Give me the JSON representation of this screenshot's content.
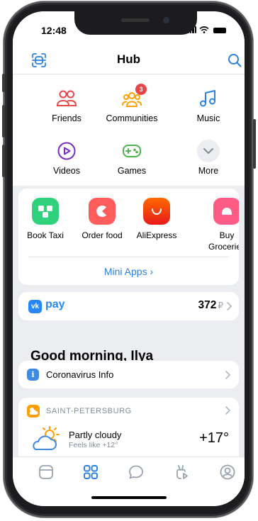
{
  "status_bar": {
    "time": "12:48"
  },
  "header": {
    "title": "Hub",
    "scan_icon": "scan-icon",
    "search_icon": "search-icon"
  },
  "services": [
    {
      "label": "Friends",
      "icon": "friends-icon",
      "color": "#e64646"
    },
    {
      "label": "Communities",
      "icon": "communities-icon",
      "color": "#ffa000",
      "badge": "3"
    },
    {
      "label": "Music",
      "icon": "music-icon",
      "color": "#2d81e0"
    },
    {
      "label": "Videos",
      "icon": "videos-icon",
      "color": "#792ec0"
    },
    {
      "label": "Games",
      "icon": "games-icon",
      "color": "#4bb34b"
    },
    {
      "label": "More",
      "icon": "chevron-down-icon",
      "color": "#818c99"
    }
  ],
  "mini_apps": {
    "items": [
      {
        "label": "Book Taxi",
        "color": "#2fd17c"
      },
      {
        "label": "Order food",
        "color": "#ff5c5c"
      },
      {
        "label": "AliExpress",
        "color": "#f23c0f"
      },
      {
        "label": "Buy Groceries",
        "color": "#ff5c85"
      }
    ],
    "link": "Mini Apps ›"
  },
  "vk_pay": {
    "logo": "vk",
    "label": "pay",
    "amount": "372",
    "currency": "₽"
  },
  "greeting": "Good morning, Ilya",
  "coronavirus": {
    "label": "Coronavirus Info"
  },
  "weather": {
    "city": "SAINT-PETERSBURG",
    "condition": "Partly cloudy",
    "feels_like": "Feels like +12°",
    "temperature": "+17°"
  },
  "tab_bar": {
    "tabs": [
      {
        "name": "news",
        "icon": "news-icon",
        "active": false
      },
      {
        "name": "services",
        "icon": "services-icon",
        "active": true
      },
      {
        "name": "messages",
        "icon": "messages-icon",
        "active": false
      },
      {
        "name": "clips",
        "icon": "clips-icon",
        "active": false
      },
      {
        "name": "profile",
        "icon": "profile-icon",
        "active": false
      }
    ],
    "active_color": "#2d81e0",
    "inactive_color": "#99a2ad"
  }
}
